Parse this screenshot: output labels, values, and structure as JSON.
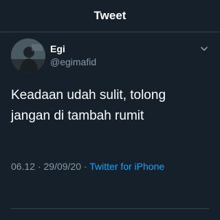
{
  "header": {
    "title": "Tweet"
  },
  "tweet": {
    "display_name": "Egi",
    "handle": "@egimafid",
    "text": "Keadaan udah sulit, tolong\njangan di tambah rumit",
    "time": "06.12",
    "separator": "·",
    "date": "29/09/20",
    "source": "Twitter for iPhone",
    "avatar_icon": "profile-photo",
    "menu_icon": "chevron-down-icon"
  },
  "colors": {
    "background": "#15202b",
    "text": "#ffffff",
    "secondary": "#8899a6",
    "link": "#1da1f2",
    "divider": "#38444d"
  }
}
